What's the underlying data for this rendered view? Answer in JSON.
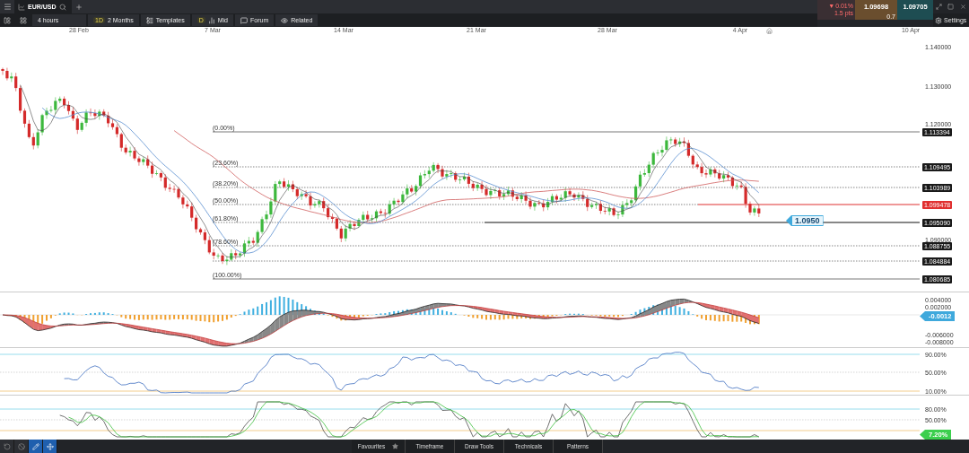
{
  "header": {
    "tab": {
      "label": "EUR/USD"
    },
    "change": {
      "arrow": "▼",
      "percent": "0.01%",
      "points": "1.5 pts"
    },
    "sell": "1.09698",
    "spread": "0.7",
    "buy": "1.09705",
    "settings": "Settings"
  },
  "controls": [
    {
      "kind": "interval",
      "label": "4 hours"
    },
    {
      "kind": "range",
      "badge": "1D",
      "label": "2 Months"
    },
    {
      "kind": "templates",
      "label": "Templates"
    },
    {
      "kind": "price",
      "badge": "D",
      "label": "Mid"
    },
    {
      "kind": "forum",
      "label": "Forum"
    },
    {
      "kind": "related",
      "label": "Related"
    }
  ],
  "dates": [
    "28 Feb",
    "7 Mar",
    "14 Mar",
    "21 Mar",
    "28 Mar",
    "4 Apr",
    "10 Apr"
  ],
  "price_chart": {
    "axis_ticks": [
      "1.140000",
      "1.130000",
      "1.120000",
      "1.090000"
    ],
    "levels": [
      {
        "label": "(0.00%)",
        "tag": "1.113394",
        "kind": "solid"
      },
      {
        "label": "(23.60%)",
        "tag": "1.109495",
        "kind": "dotted"
      },
      {
        "label": "(38.20%)",
        "tag": "1.103989",
        "kind": "dotted"
      },
      {
        "label": "(50.00%)",
        "tag": "1.099478",
        "kind": "alert"
      },
      {
        "label": "(61.80%)",
        "tag": "1.095090",
        "kind": "support"
      },
      {
        "label": "(78.60%)",
        "tag": "1.088755",
        "kind": "dotted"
      },
      {
        "tag": "1.084884",
        "kind": "dotted"
      },
      {
        "label": "(100.00%)",
        "tag": "1.080685",
        "kind": "solid"
      }
    ],
    "current_price": "1.0950"
  },
  "macd": {
    "axis_ticks": [
      "0.004000",
      "0.002000",
      "-0.006000",
      "-0.008000"
    ],
    "current": "-0.0012"
  },
  "rsi": {
    "axis_ticks": [
      "90.00%",
      "50.00%",
      "10.00%"
    ]
  },
  "stochastic": {
    "axis_ticks": [
      "80.00%",
      "50.00%"
    ],
    "current": "7.20%"
  },
  "tools": [
    {
      "kind": "refresh",
      "selected": false
    },
    {
      "kind": "clear",
      "selected": false
    },
    {
      "kind": "draw",
      "selected": true
    },
    {
      "kind": "select",
      "selected": true
    }
  ],
  "menus": [
    {
      "kind": "favourites",
      "label": "Favourites"
    },
    {
      "kind": "plain",
      "label": "Timeframe"
    },
    {
      "kind": "plain",
      "label": "Draw Tools"
    },
    {
      "kind": "plain",
      "label": "Technicals"
    },
    {
      "kind": "plain",
      "label": "Patterns"
    }
  ]
}
